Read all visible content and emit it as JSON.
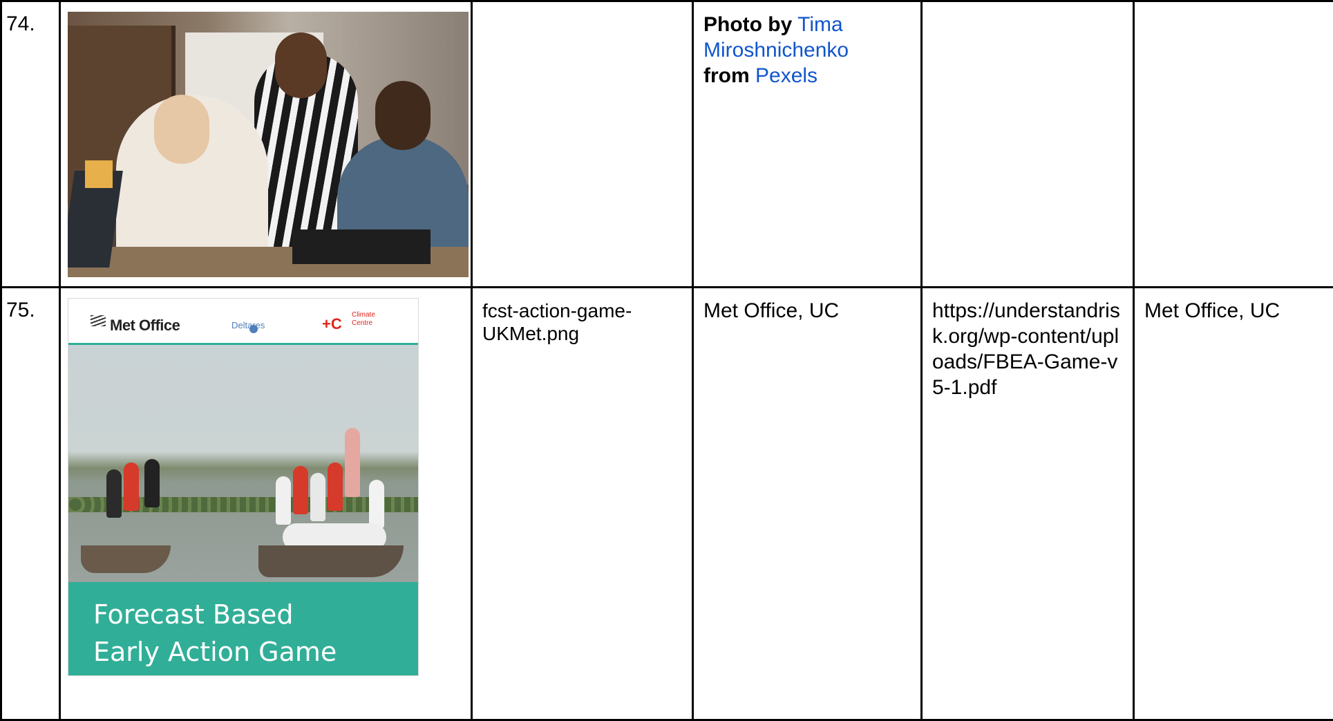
{
  "rows": [
    {
      "number": "74.",
      "image_alt": "Three people working together at a desk",
      "filename": "",
      "credit": {
        "photo_by_label": "Photo by",
        "photographer": "Tima Miroshnichenko",
        "from_label": "from",
        "source": "Pexels"
      },
      "url": "",
      "license": ""
    },
    {
      "number": "75.",
      "cover": {
        "logo_metoffice": "Met Office",
        "logo_deltares": "Deltares",
        "logo_redcross": "+C",
        "logo_climate": "Climate Centre",
        "title_line1": "Forecast Based",
        "title_line2": "Early Action Game"
      },
      "filename": "fcst-action-game-UKMet.png",
      "credit_text": "Met Office, UC",
      "url": "https://understandrisk.org/wp-content/uploads/FBEA-Game-v5-1.pdf",
      "license": "Met Office, UC"
    }
  ],
  "colors": {
    "link": "#1155cc",
    "border": "#000000",
    "cover_teal": "#31ae97"
  }
}
